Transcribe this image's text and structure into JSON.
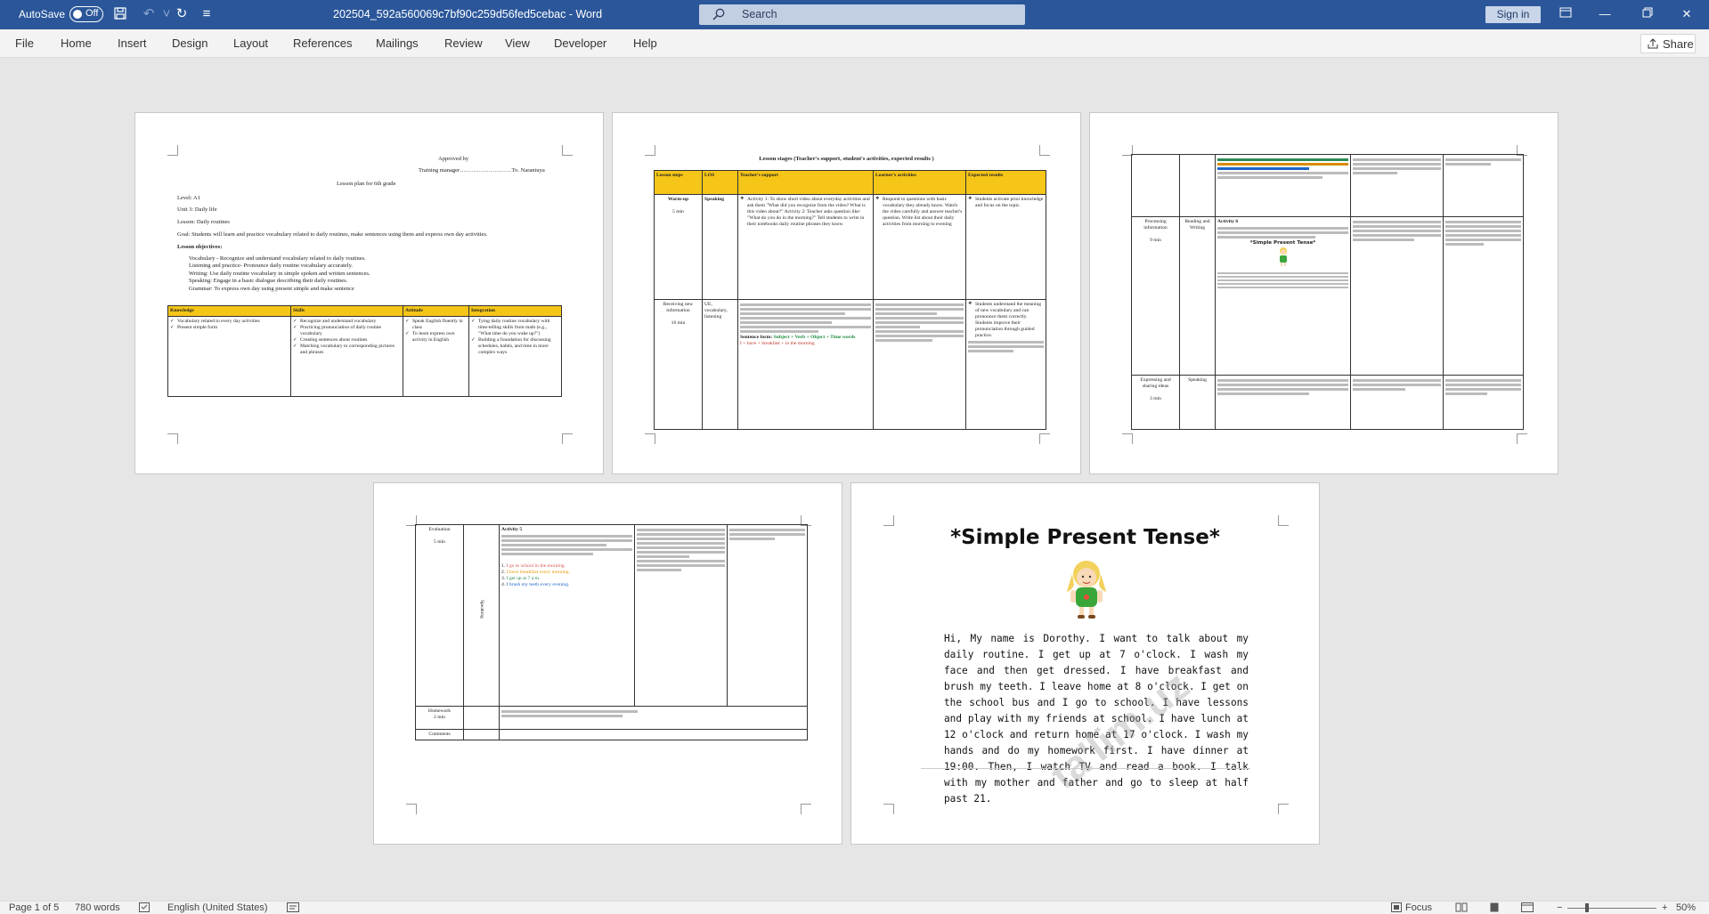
{
  "titlebar": {
    "autosave_label": "AutoSave",
    "autosave_state": "Off",
    "document_title": "202504_592a560069c7bf90c259d56fed5cebac",
    "app_name": "Word",
    "search_placeholder": "Search",
    "signin_label": "Sign in",
    "accent_color": "#2b579a"
  },
  "ribbon": {
    "tabs": [
      "File",
      "Home",
      "Insert",
      "Design",
      "Layout",
      "References",
      "Mailings",
      "Review",
      "View",
      "Developer",
      "Help"
    ],
    "share_label": "Share"
  },
  "page1": {
    "approved": "Approved by",
    "manager": "Training manager………………………To. Narantuya",
    "plan_title": "Lesson plan for 6th grade",
    "level": "Level: A1",
    "unit": "Unit 3: Daily life",
    "lesson": "Lesson: Daily routines",
    "goal": "Goal: Students will learn and practice vocabulary related to daily routines, make sentences using them and express own day activities.",
    "objectives_heading": "Lesson objectives:",
    "objectives": [
      "Vocabulary - Recognize and understand vocabulary related to daily routines.",
      "Listening and practice- Pronounce daily routine vocabulary accurately.",
      "Writing: Use daily routine vocabulary in simple spoken and written sentences.",
      "Speaking: Engage in a basic dialogue describing their daily routines.",
      "Grammar: To express own day using present simple and make sentence"
    ],
    "table_headers": [
      "Knowledge",
      "Skills",
      "Attitude",
      "Integration"
    ],
    "table_cells": [
      [
        "Vocabulary related to every day activities",
        "Present simple form"
      ],
      [
        "Recognize and understand vocabulary",
        "Practicing pronunciation of daily routine vocabulary",
        "Creating sentences about routines",
        "Matching vocabulary to corresponding pictures and phrases"
      ],
      [
        "Speak English fluently in class",
        "To learn express own activity in English"
      ],
      [
        "Tying daily routine vocabulary with time-telling skills from math (e.g., \"What time do you wake up?\")",
        "Building a foundation for discussing schedules, habits, and time in more complex ways"
      ]
    ]
  },
  "page2": {
    "heading": "Lesson stages (Teacher's support, student's activities, expected results )",
    "headers": [
      "Lesson steps",
      "LOS",
      "Teacher's support",
      "Learner's activities",
      "Expected results"
    ],
    "row1": {
      "step": "Warm-up",
      "time": "5 min",
      "los": "Speaking",
      "teacher": "Activity 1: To show short video about everyday activities and ask them \"What did you recognize from the video? What is this video about?\" Activity 2: Teacher asks question like: \"What do you do in the morning?\" Tell students to write in their notebooks daily routine phrases they know",
      "learner": "Respond to questions with basic vocabulary they already know. Watch the video carefully and answer teacher's question. Write list about their daily activities from morning to evening",
      "expected": "Students activate prior knowledge and focus on the topic."
    },
    "row2": {
      "step": "Receiving new information",
      "time": "16 min",
      "los": "UE, vocabulary, listening",
      "sentence_form_label": "Sentence form:",
      "sentence_form": "Subject + Verb + Object + Time words",
      "example": "I + have + breakfast + in the morning",
      "expected": "Students understand the meaning of new vocabulary and can pronounce them correctly. Students improve their pronunciation through guided practice."
    }
  },
  "page3": {
    "rows": [
      {
        "step": "Processing information",
        "time": "9 min",
        "los": "Reading and Writing",
        "activity": "Activity 6",
        "subtitle": "*Simple Present Tense*"
      },
      {
        "step": "Expressing and sharing ideas",
        "time": "3 min",
        "los": "Speaking"
      }
    ]
  },
  "page4": {
    "rows": [
      {
        "step": "Evaluation",
        "time": "5 min",
        "los": "Speaking",
        "activity": "Activity 5"
      },
      {
        "step": "Homework",
        "time": "2 min"
      },
      {
        "step": "Comments"
      }
    ],
    "sentences": [
      "I go to school in the morning.",
      "I have breakfast every morning.",
      "I get up at 7 a.m.",
      "I brush my teeth every evening."
    ],
    "sentence_colors": [
      "#d9534f",
      "#e69500",
      "#2e8b57",
      "#1e66c9"
    ]
  },
  "page5": {
    "title": "*Simple Present Tense*",
    "body": "Hi, My name is Dorothy. I want to talk about my daily routine. I get up at 7 o'clock. I wash my face and then get dressed. I have breakfast and brush my teeth. I leave home at 8 o'clock. I get on the school bus and I go to school. I have lessons and play with my friends at school. I have lunch at 12 o'clock and return home at 17 o'clock. I wash my hands and do my homework first. I have dinner at 19:00. Then, I watch TV and read a book. I talk with my mother and father and go to sleep at half past 21."
  },
  "statusbar": {
    "page_info": "Page 1 of 5",
    "word_count": "780 words",
    "language": "English (United States)",
    "focus_label": "Focus",
    "zoom_percent": 50,
    "zoom_label": "50%"
  }
}
